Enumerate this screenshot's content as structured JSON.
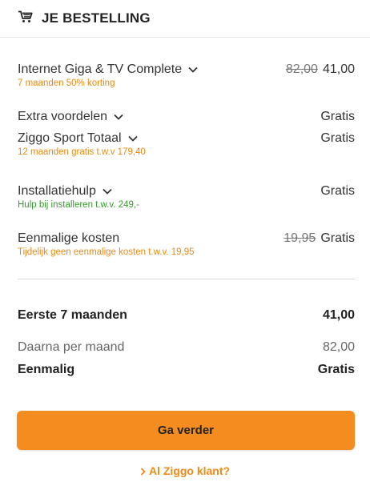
{
  "header": {
    "title": "JE BESTELLING",
    "icon": "shopping-cart-icon"
  },
  "items": [
    {
      "label": "Internet Giga & TV Complete",
      "sub": "7 maanden 50% korting",
      "old_price": "82,00",
      "price": "41,00"
    },
    {
      "label": "Extra voordelen",
      "price": "Gratis"
    },
    {
      "label": "Ziggo Sport Totaal",
      "sub": "12 maanden gratis t.w.v 179,40",
      "price": "Gratis"
    },
    {
      "label": "Installatiehulp",
      "sub": "Hulp bij installeren t.w.v. 249,-",
      "price": "Gratis"
    },
    {
      "label": "Eenmalige kosten",
      "sub": "Tijdelijk geen eenmalige kosten t.w.v. 19,95",
      "old_price": "19,95",
      "price": "Gratis"
    }
  ],
  "summary": {
    "first_label": "Eerste 7 maanden",
    "first_value": "41,00",
    "after_label": "Daarna per maand",
    "after_value": "82,00",
    "once_label": "Eenmalig",
    "once_value": "Gratis"
  },
  "cta": {
    "button": "Ga verder",
    "link": "Al Ziggo klant?"
  },
  "colors": {
    "accent": "#f48c1f",
    "sub_orange": "#e98a13",
    "sub_green": "#3a9a33"
  }
}
